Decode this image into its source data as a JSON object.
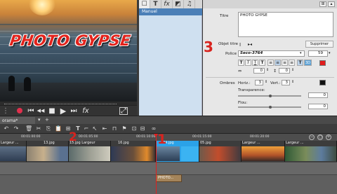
{
  "preview": {
    "overlay_title": "PHOTO GYPSE",
    "transport": {
      "record_icon": "record-icon",
      "skip_back": "⏮",
      "rewind": "◀◀",
      "stop": "■",
      "play": "▶",
      "skip_forward": "⏭",
      "fx": "fx",
      "fullscreen": "⤢"
    }
  },
  "effects_panel": {
    "tabs": [
      "☐",
      "T",
      "fx",
      "◩",
      "♫"
    ],
    "selected_item": "Manuel"
  },
  "title_props": {
    "titre_label": "Titre",
    "titre_value": "PHOTO GYPSE",
    "delete_button": "Supprimer",
    "objet_titre_label": "Objet titre",
    "police_label": "Police",
    "police_value": "Seco-3764",
    "font_size": "59",
    "format_buttons": [
      "T",
      "T",
      "T",
      "T",
      "≡",
      "≡",
      "≡",
      "≡",
      "T",
      "3D"
    ],
    "spacing_value_1": "0",
    "spacing_value_2": "0",
    "ombres_label": "Ombres",
    "horiz_label": "Horiz.:",
    "horiz_value": "3",
    "vert_label": "Vert.:",
    "vert_value": "3",
    "transparence_label": "Transparence:",
    "transparence_value": "0",
    "flou_label": "Flou:",
    "flou_value": "0",
    "colors": {
      "red_swatch": "#e01b1b",
      "accent_blue": "#4b7fb7"
    }
  },
  "project": {
    "tab_label": "orama*",
    "timecodes": [
      "00:01:00:00",
      "00:01:05:00",
      "00:01:10:00",
      "00:01:15:00",
      "00:01:20:00"
    ],
    "clips": [
      {
        "label": "Largeur ..."
      },
      {
        "label": "13.jpg"
      },
      {
        "label": "15.jpg Largeur"
      },
      {
        "label": "16.jpg"
      },
      {
        "label": "04.jpg"
      },
      {
        "label": "05.jpg"
      },
      {
        "label": "Largeur ..."
      },
      {
        "label": "Largeur ..."
      }
    ],
    "title_clip": "PHOTO..."
  },
  "annotations": {
    "one": "1",
    "two": "2",
    "three": "3"
  }
}
